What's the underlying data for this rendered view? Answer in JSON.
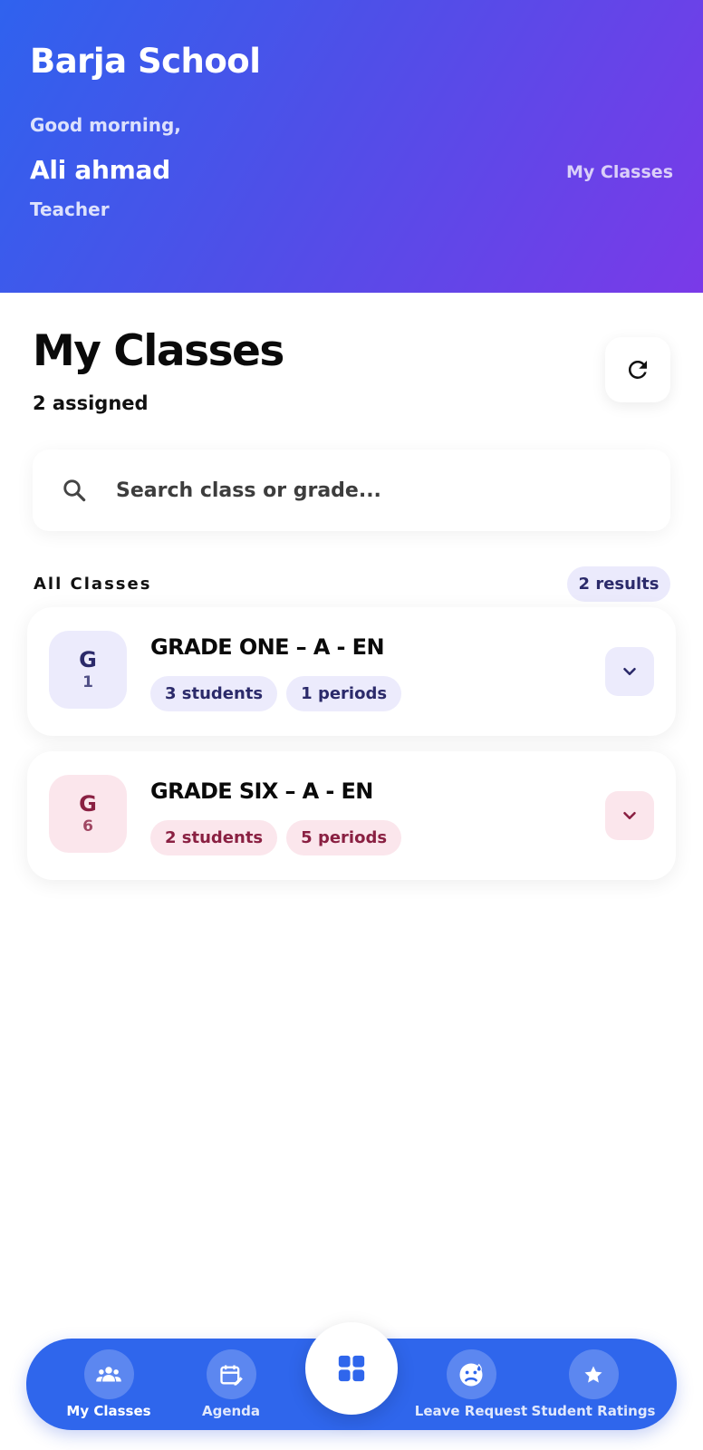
{
  "header": {
    "school_name": "Barja School",
    "greeting": "Good morning,",
    "user_name": "Ali ahmad",
    "user_role": "Teacher",
    "header_link": "My Classes"
  },
  "main": {
    "title": "My Classes",
    "assigned_count": "2 assigned",
    "search": {
      "placeholder": "Search class or grade...",
      "value": ""
    },
    "section_label": "All Classes",
    "results_badge": "2 results"
  },
  "classes": [
    {
      "avatar_letter": "G",
      "avatar_number": "1",
      "name": "GRADE ONE – A - EN",
      "students": "3 students",
      "periods": "1 periods",
      "theme_color": "#2b2a6a"
    },
    {
      "avatar_letter": "G",
      "avatar_number": "6",
      "name": "GRADE SIX – A - EN",
      "students": "2 students",
      "periods": "5 periods",
      "theme_color": "#8a2042"
    }
  ],
  "bottom_nav": {
    "items": [
      {
        "label": "My Classes",
        "icon": "people-icon"
      },
      {
        "label": "Agenda",
        "icon": "calendar-edit-icon"
      },
      {
        "label": "Leave Request",
        "icon": "sick-face-icon"
      },
      {
        "label": "Student Ratings",
        "icon": "star-icon"
      }
    ],
    "center_icon": "grid-dashboard-icon"
  },
  "colors": {
    "primary": "#2f66ec",
    "header_gradient_start": "#2f62ee",
    "header_gradient_end": "#7a3ae8"
  }
}
